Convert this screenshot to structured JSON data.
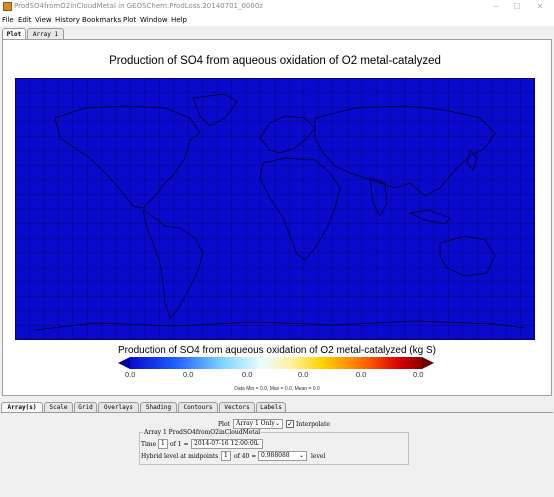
{
  "window": {
    "title": "ProdSO4fromO2inCloudMetal in GEOSChem.ProdLoss.20140701_0000z",
    "minimize": "─",
    "maximize": "☐",
    "close": "✕"
  },
  "menu": [
    "File",
    "Edit",
    "View",
    "History",
    "Bookmarks",
    "Plot",
    "Window",
    "Help"
  ],
  "top_tabs": [
    "Plot",
    "Array 1"
  ],
  "plot": {
    "title": "Production of SO4 from aqueous oxidation of O2 metal-catalyzed",
    "map_fill": "#0a0acc",
    "colorbar_title": "Production of SO4 from aqueous oxidation of O2 metal-catalyzed (kg S)",
    "colorbar_ticks": [
      "0.0",
      "0.0",
      "0.0",
      "0.0",
      "0.0",
      "0.0"
    ],
    "stats": "Data Min = 0.0, Max = 0.0, Mean = 0.0"
  },
  "bottom_tabs": [
    "Array(s)",
    "Scale",
    "Grid",
    "Overlays",
    "Shading",
    "Contours",
    "Vectors",
    "Labels"
  ],
  "controls": {
    "plot_label": "Plot",
    "plot_select": "Array 1 Only",
    "interpolate_label": "Interpolate",
    "interpolate_checked": true,
    "array_caption": "Array 1  ProdSO4fromO2inCloudMetal",
    "time_label": "Time",
    "time_index": "1",
    "time_of": "of 1 =",
    "time_value": "2014-07-16 12:00:00",
    "level_label": "Hybrid level at midpoints",
    "level_index": "1",
    "level_of": "of 40 =",
    "level_value": "0.988088",
    "level_units": "level"
  }
}
